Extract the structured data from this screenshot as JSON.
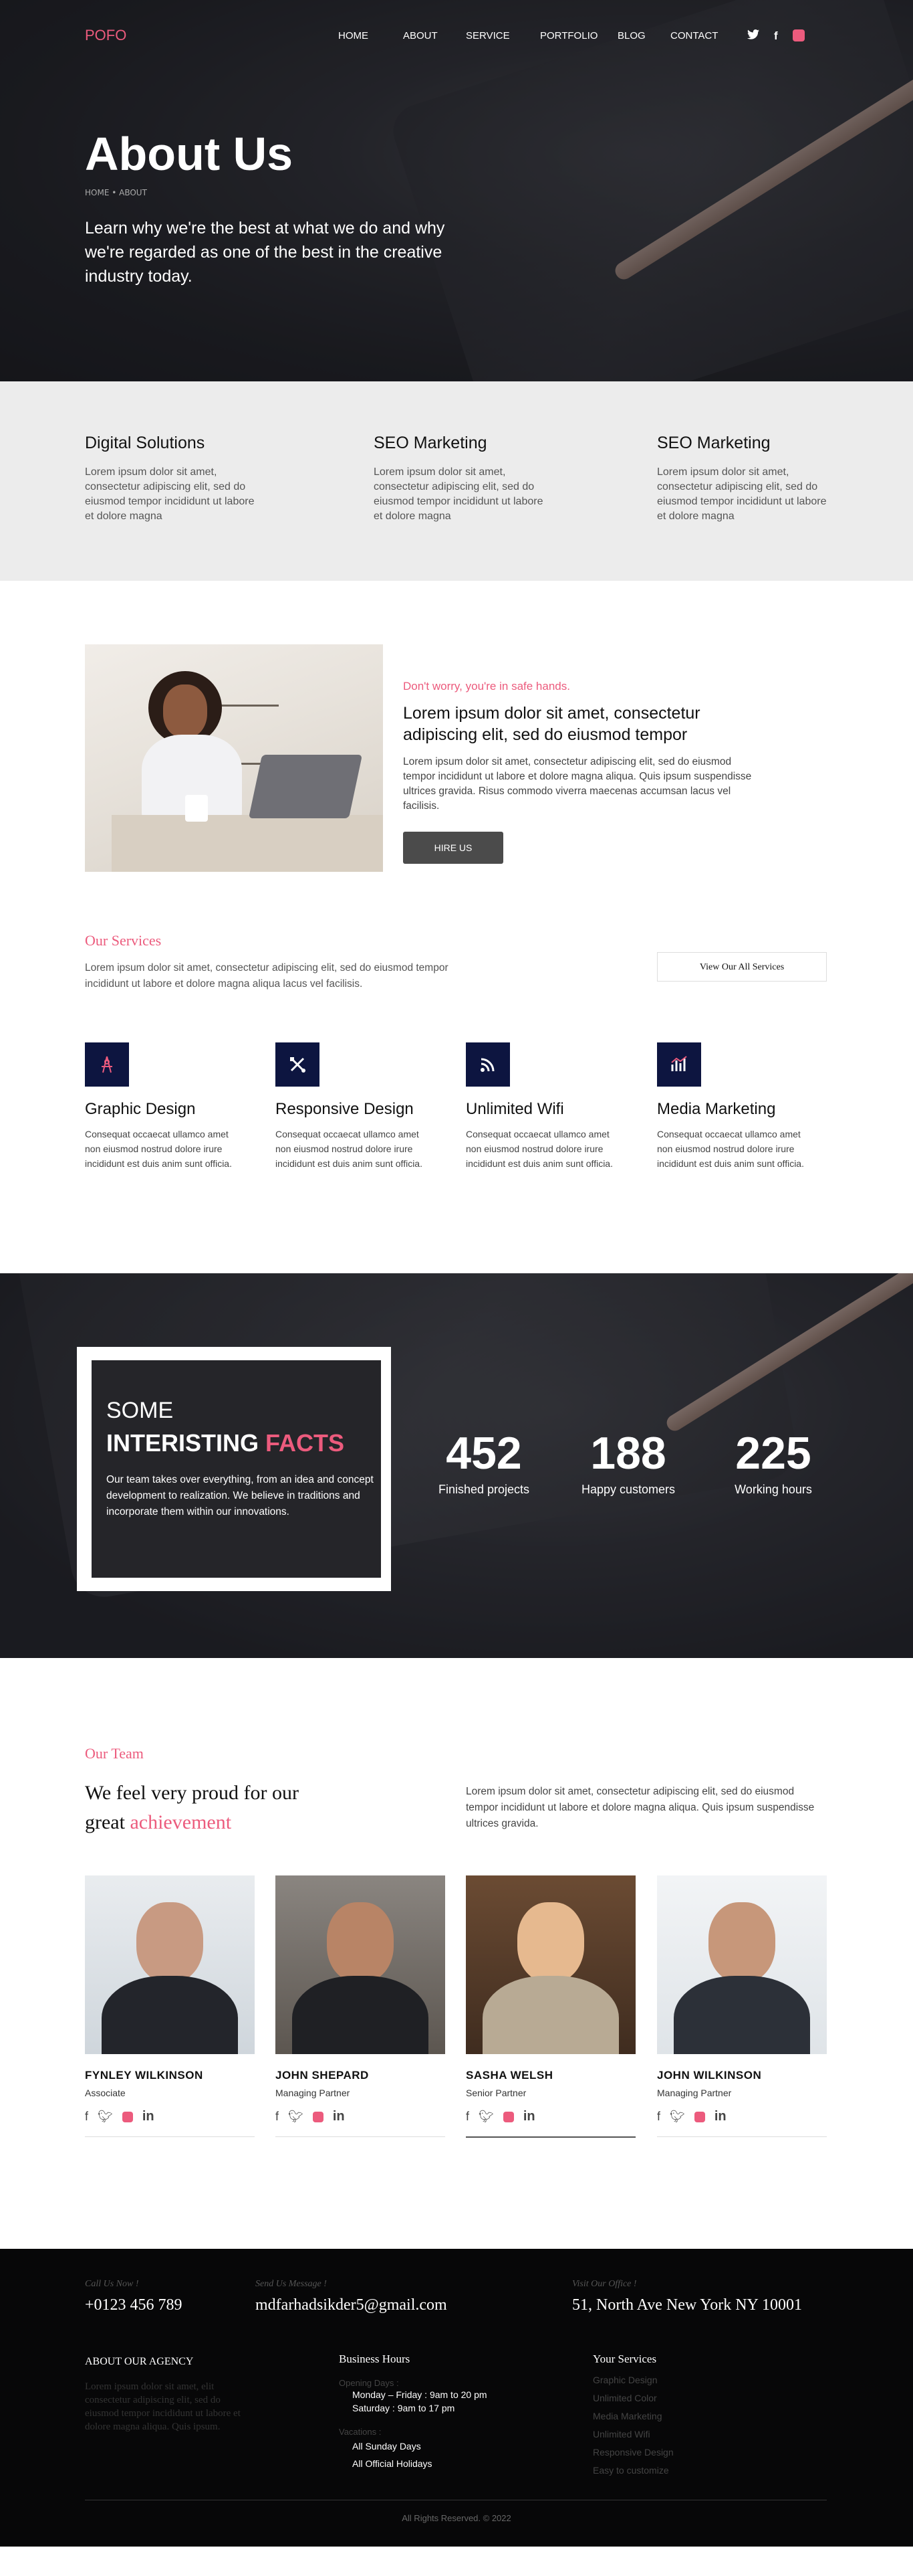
{
  "nav": {
    "logo": "POFO",
    "items": [
      "HOME",
      "ABOUT",
      "SERVICE",
      "PORTFOLIO",
      "BLOG",
      "CONTACT"
    ],
    "social": {
      "twitter": "twitter-icon",
      "facebook": "f",
      "instagram": "instagram-icon"
    }
  },
  "hero": {
    "title": "About Us",
    "breadcrumb": "HOME • ABOUT",
    "subtitle": "Learn why we're the best at what we do and why we're regarded as one of the best in the creative industry today."
  },
  "features": [
    {
      "title": "Digital Solutions",
      "text": "Lorem ipsum dolor sit amet, consectetur adipiscing elit, sed do eiusmod tempor incididunt ut labore et dolore magna"
    },
    {
      "title": "SEO Marketing",
      "text": "Lorem ipsum dolor sit amet, consectetur adipiscing elit, sed do eiusmod tempor incididunt ut labore et dolore magna"
    },
    {
      "title": "SEO Marketing",
      "text": "Lorem ipsum dolor sit amet, consectetur adipiscing elit, sed do eiusmod tempor incididunt ut labore et dolore magna"
    }
  ],
  "about": {
    "kicker": "Don't worry, you're in safe hands.",
    "heading": "Lorem ipsum dolor sit amet, consectetur adipiscing elit, sed do eiusmod tempor",
    "text": "Lorem ipsum dolor sit amet, consectetur adipiscing elit, sed do eiusmod tempor incididunt ut labore et dolore magna aliqua. Quis ipsum suspendisse ultrices gravida. Risus commodo viverra maecenas accumsan lacus vel facilisis.",
    "button": "HIRE US"
  },
  "services": {
    "kicker": "Our Services",
    "lead": "Lorem ipsum dolor sit amet, consectetur adipiscing elit, sed do eiusmod tempor incididunt ut labore et dolore magna aliqua lacus vel facilisis.",
    "button": "View Our All Services",
    "items": [
      {
        "icon": "design-icon",
        "title": "Graphic Design",
        "text": "Consequat occaecat ullamco amet non eiusmod nostrud dolore irure incididunt est duis anim sunt officia."
      },
      {
        "icon": "tools-icon",
        "title": "Responsive Design",
        "text": "Consequat occaecat ullamco amet non eiusmod nostrud dolore irure incididunt est duis anim sunt officia."
      },
      {
        "icon": "wifi-icon",
        "title": "Unlimited Wifi",
        "text": "Consequat occaecat ullamco amet non eiusmod nostrud dolore irure incididunt est duis anim sunt officia."
      },
      {
        "icon": "chart-icon",
        "title": "Media Marketing",
        "text": "Consequat occaecat ullamco amet non eiusmod nostrud dolore irure incididunt est duis anim sunt officia."
      }
    ]
  },
  "facts": {
    "some": "SOME",
    "interisting": "INTERISTING",
    "facts_word": "FACTS",
    "text": "Our team takes over everything, from an idea and concept development to realization. We believe in traditions and incorporate them within our innovations.",
    "stats": [
      {
        "number": "452",
        "label": "Finished projects"
      },
      {
        "number": "188",
        "label": "Happy customers"
      },
      {
        "number": "225",
        "label": "Working hours"
      }
    ]
  },
  "team": {
    "kicker": "Our Team",
    "heading_pre": "We feel very proud for our",
    "heading_great": "great",
    "heading_accent": "achievement",
    "lead": "Lorem ipsum dolor sit amet, consectetur adipiscing elit, sed do eiusmod tempor incididunt ut labore et dolore magna aliqua. Quis ipsum suspendisse ultrices gravida.",
    "members": [
      {
        "name": "FYNLEY WILKINSON",
        "role": "Associate"
      },
      {
        "name": "JOHN SHEPARD",
        "role": "Managing Partner"
      },
      {
        "name": "SASHA WELSH",
        "role": "Senior Partner"
      },
      {
        "name": "JOHN WILKINSON",
        "role": "Managing Partner"
      }
    ]
  },
  "footer": {
    "call_label": "Call Us Now !",
    "call_value": "+0123 456 789",
    "mail_label": "Send Us Message !",
    "mail_value": "mdfarhadsikder5@gmail.com",
    "office_label": "Visit Our Office !",
    "office_value": "51, North Ave New York NY 10001",
    "agency_title": "ABOUT OUR AGENCY",
    "agency_text": "Lorem ipsum dolor sit amet, elit consectetur adipiscing elit, sed do eiusmod tempor incididunt ut labore et dolore magna aliqua. Quis ipsum.",
    "hours_title": "Business Hours",
    "opening_label": "Opening Days :",
    "opening_1": "Monday – Friday : 9am to 20 pm",
    "opening_2": "Saturday : 9am to 17 pm",
    "vacation_label": "Vacations :",
    "vacation_1": "All Sunday Days",
    "vacation_2": "All Official Holidays",
    "services_title": "Your  Services",
    "services": [
      "Graphic Design",
      "Unlimited Color",
      "Media Marketing",
      "Unlimited Wifi",
      "Responsive Design",
      "Easy to customize"
    ],
    "copyright": "All Rights Reserved. © 2022"
  }
}
